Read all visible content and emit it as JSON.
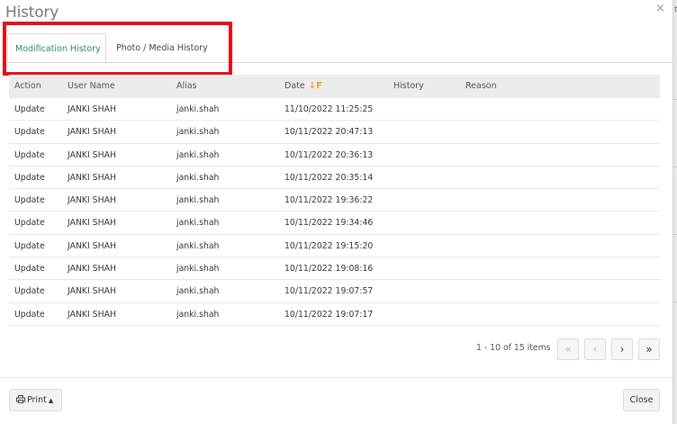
{
  "dialog": {
    "title": "History",
    "close_glyph": "×"
  },
  "tabs": [
    {
      "label": "Modification History",
      "active": true
    },
    {
      "label": "Photo / Media History",
      "active": false
    }
  ],
  "table": {
    "columns": [
      "Action",
      "User Name",
      "Alias",
      "Date",
      "History",
      "Reason"
    ],
    "sort_icon": "↓F",
    "rows": [
      [
        "Update",
        "JANKI SHAH",
        "janki.shah",
        "11/10/2022 11:25:25",
        "",
        ""
      ],
      [
        "Update",
        "JANKI SHAH",
        "janki.shah",
        "10/11/2022 20:47:13",
        "",
        ""
      ],
      [
        "Update",
        "JANKI SHAH",
        "janki.shah",
        "10/11/2022 20:36:13",
        "",
        ""
      ],
      [
        "Update",
        "JANKI SHAH",
        "janki.shah",
        "10/11/2022 20:35:14",
        "",
        ""
      ],
      [
        "Update",
        "JANKI SHAH",
        "janki.shah",
        "10/11/2022 19:36:22",
        "",
        ""
      ],
      [
        "Update",
        "JANKI SHAH",
        "janki.shah",
        "10/11/2022 19:34:46",
        "",
        ""
      ],
      [
        "Update",
        "JANKI SHAH",
        "janki.shah",
        "10/11/2022 19:15:20",
        "",
        ""
      ],
      [
        "Update",
        "JANKI SHAH",
        "janki.shah",
        "10/11/2022 19:08:16",
        "",
        ""
      ],
      [
        "Update",
        "JANKI SHAH",
        "janki.shah",
        "10/11/2022 19:07:57",
        "",
        ""
      ],
      [
        "Update",
        "JANKI SHAH",
        "janki.shah",
        "10/11/2022 19:07:17",
        "",
        ""
      ]
    ]
  },
  "pager": {
    "info": "1 - 10 of 15 items",
    "first_glyph": "«",
    "prev_glyph": "‹",
    "next_glyph": "›",
    "last_glyph": "»"
  },
  "footer": {
    "print_label": "Print",
    "print_caret": "▲",
    "close_label": "Close"
  },
  "background": {
    "edge_text": "t"
  },
  "colors": {
    "active_tab": "#2e8b57",
    "highlight": "#e8101a",
    "sort_icon": "#e6a23c",
    "header_bg": "#ececec"
  }
}
